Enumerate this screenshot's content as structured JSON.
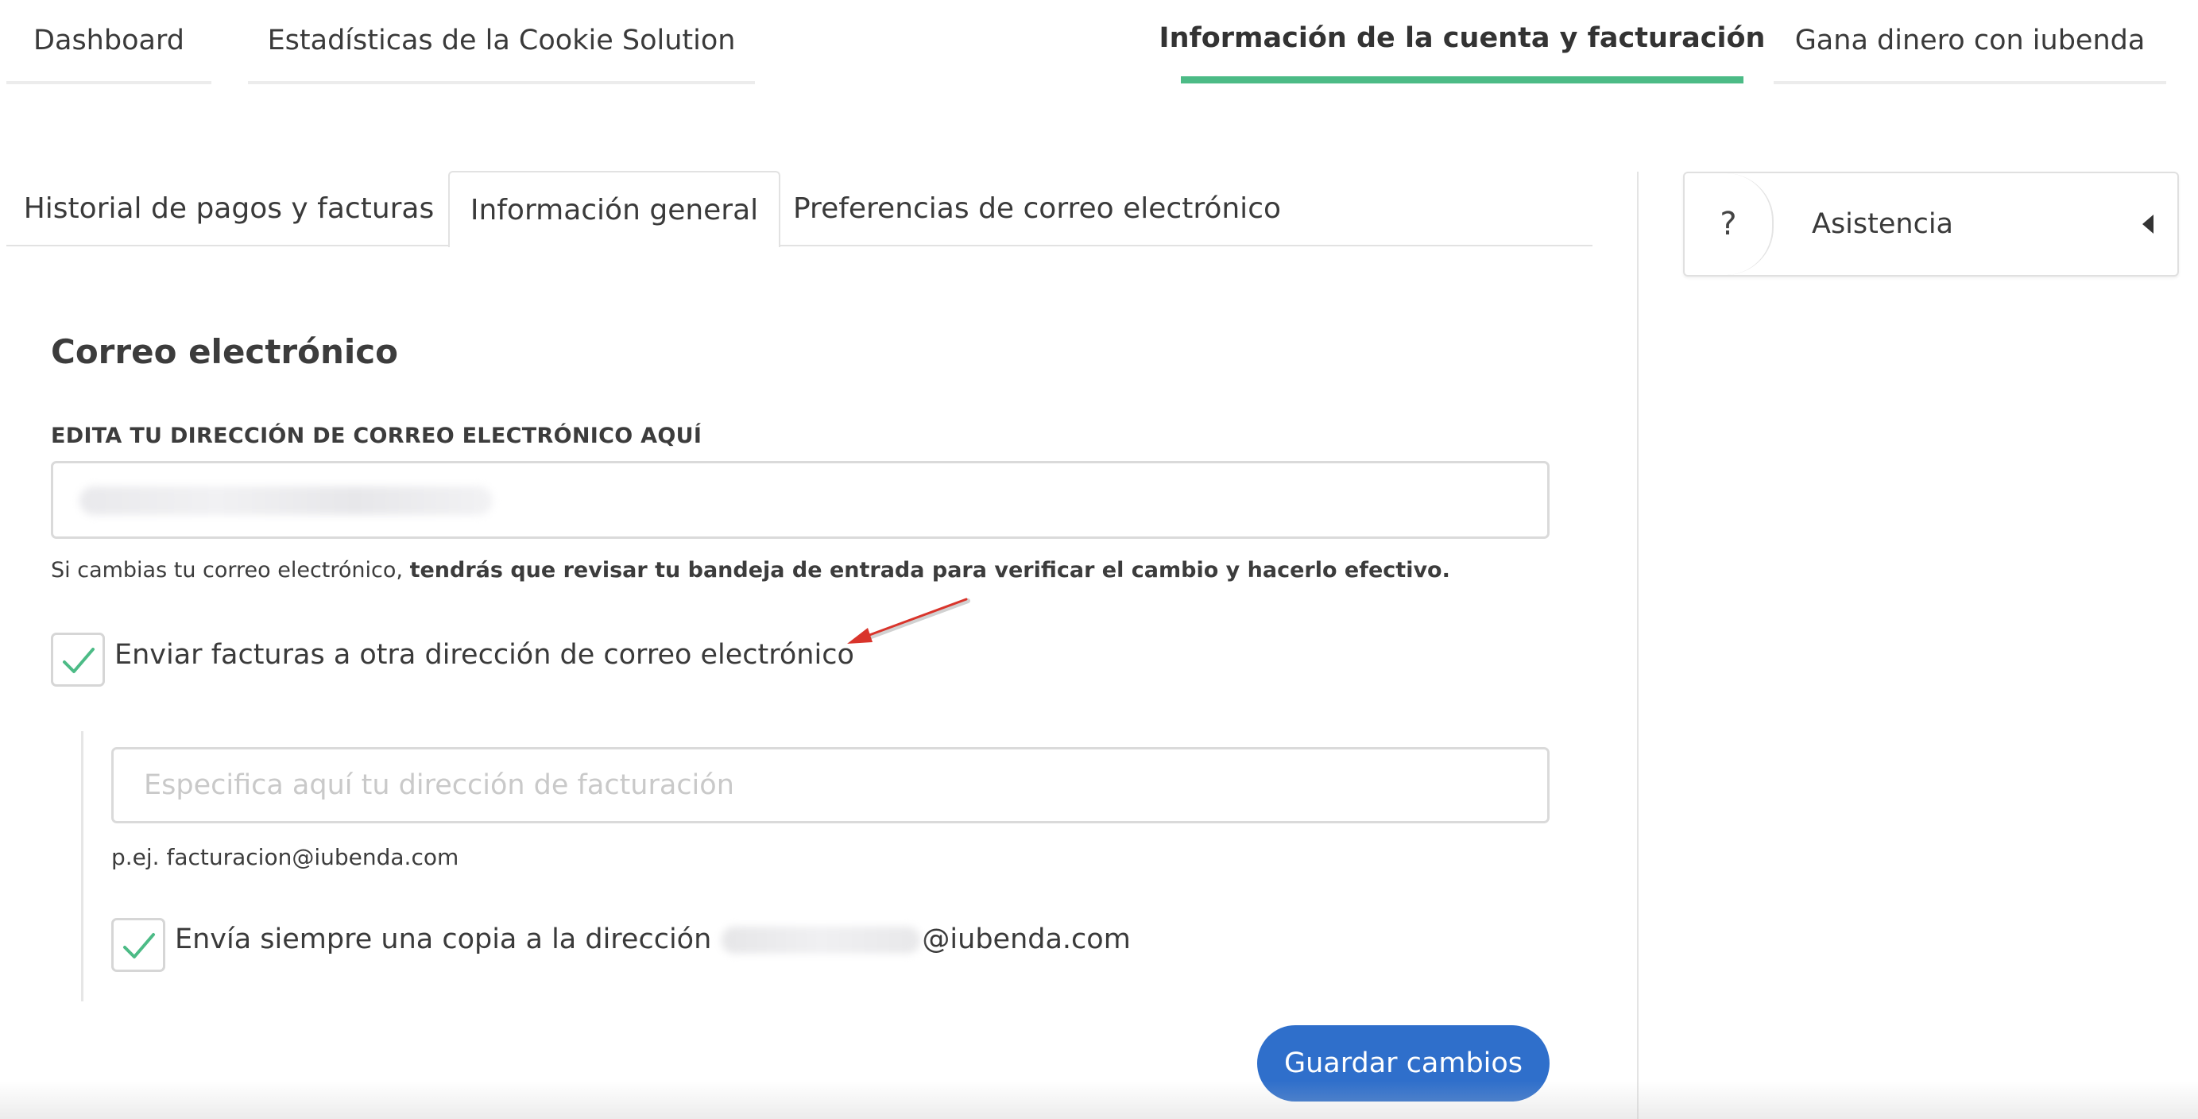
{
  "top_nav": {
    "tabs": [
      {
        "label": "Dashboard"
      },
      {
        "label": "Estadísticas de la Cookie Solution"
      },
      {
        "label": "Información de la cuenta y facturación"
      },
      {
        "label": "Gana dinero con iubenda"
      }
    ],
    "active_index": 2
  },
  "sub_tabs": {
    "tabs": [
      {
        "label": "Historial de pagos y facturas"
      },
      {
        "label": "Información general"
      },
      {
        "label": "Preferencias de correo electrónico"
      }
    ],
    "active_index": 1
  },
  "email_section": {
    "title": "Correo electrónico",
    "field_label": "EDITA TU DIRECCIÓN DE CORREO ELECTRÓNICO AQUÍ",
    "helper_prefix": "Si cambias tu correo electrónico,",
    "helper_bold": "tendrás que revisar tu bandeja de entrada para verificar el cambio y hacerlo efectivo."
  },
  "billing": {
    "checkbox_label": "Enviar facturas a otra dirección de correo electrónico",
    "checked": true,
    "input_placeholder": "Especifica aquí tu dirección de facturación",
    "example": "p.ej. facturacion@iubenda.com",
    "copy_label_prefix": "Envía siempre una copia a la dirección",
    "copy_label_suffix": "@iubenda.com",
    "copy_checked": true
  },
  "save_button": {
    "label": "Guardar cambios"
  },
  "support": {
    "title": "Asistencia",
    "icon_glyph": "?"
  },
  "colors": {
    "accent_green": "#4cbb86",
    "primary_blue": "#2f6fcb",
    "arrow_red": "#d9342b"
  },
  "icons": [
    "question-icon",
    "caret-left-icon",
    "checkmark-icon",
    "annotation-arrow-icon"
  ]
}
